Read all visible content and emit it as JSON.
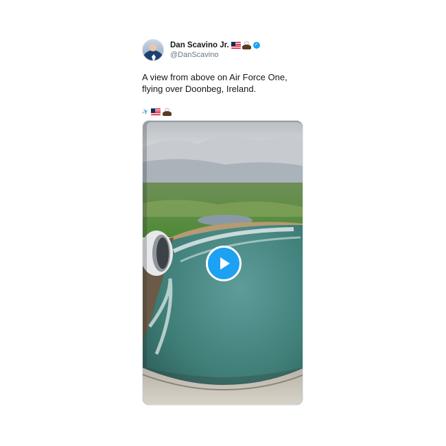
{
  "tweet": {
    "author": {
      "display_name": "Dan Scavino Jr.",
      "handle": "@DanScavino",
      "name_emojis": [
        "us-flag",
        "eagle"
      ],
      "verified": true
    },
    "text_lines": [
      "A view from above on Air Force One,",
      "flying over Doonbeg, Ireland."
    ],
    "emoji_line": [
      "airplane",
      "us-flag",
      "eagle"
    ],
    "media": {
      "type": "video",
      "description_icon": "play-icon"
    }
  },
  "colors": {
    "accent": "#1da1f2",
    "text": "#14171a",
    "secondary_text": "#657786"
  }
}
